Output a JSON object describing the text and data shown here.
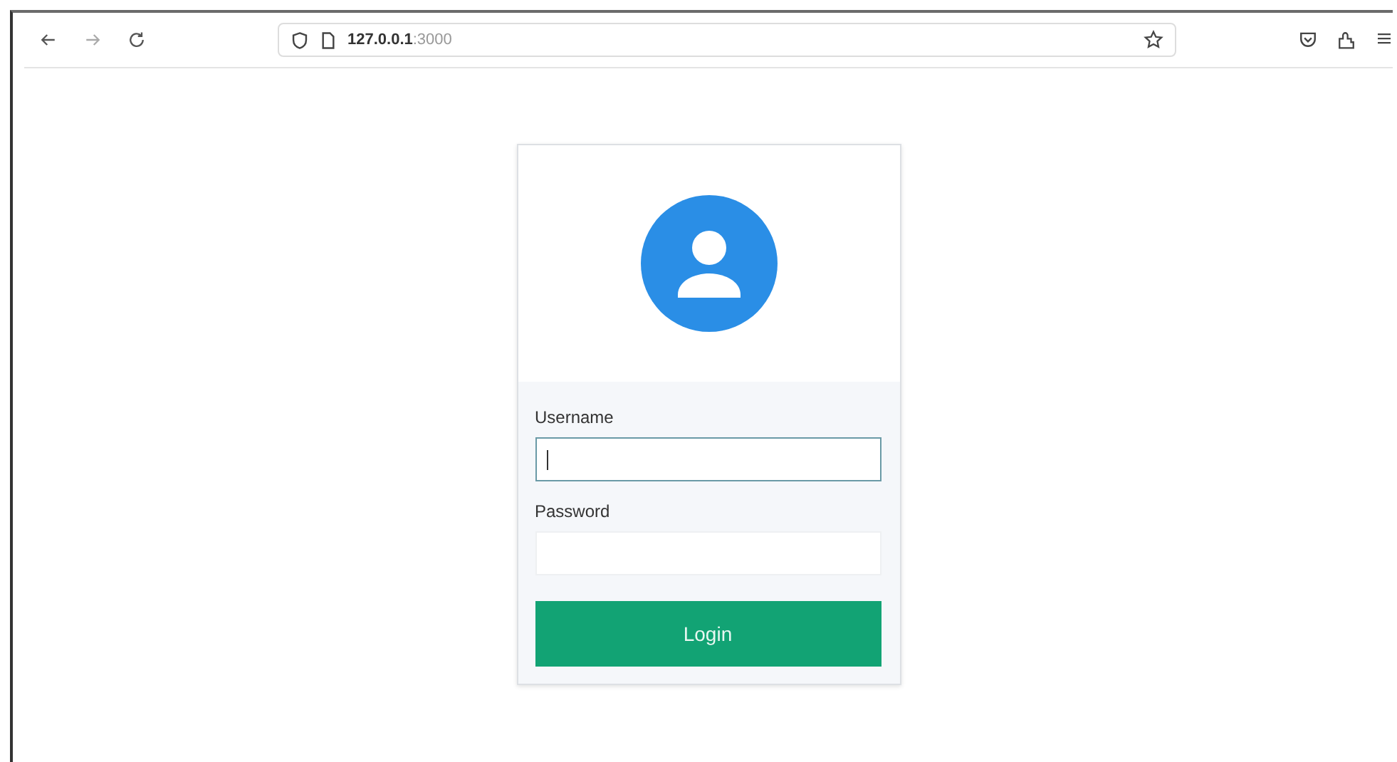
{
  "browser": {
    "url_host": "127.0.0.1",
    "url_port": ":3000",
    "back_enabled": true,
    "forward_enabled": false
  },
  "login_form": {
    "fields": [
      {
        "label": "Username",
        "focused": true
      },
      {
        "label": "Password",
        "focused": false
      }
    ],
    "submit_button": "Login"
  }
}
